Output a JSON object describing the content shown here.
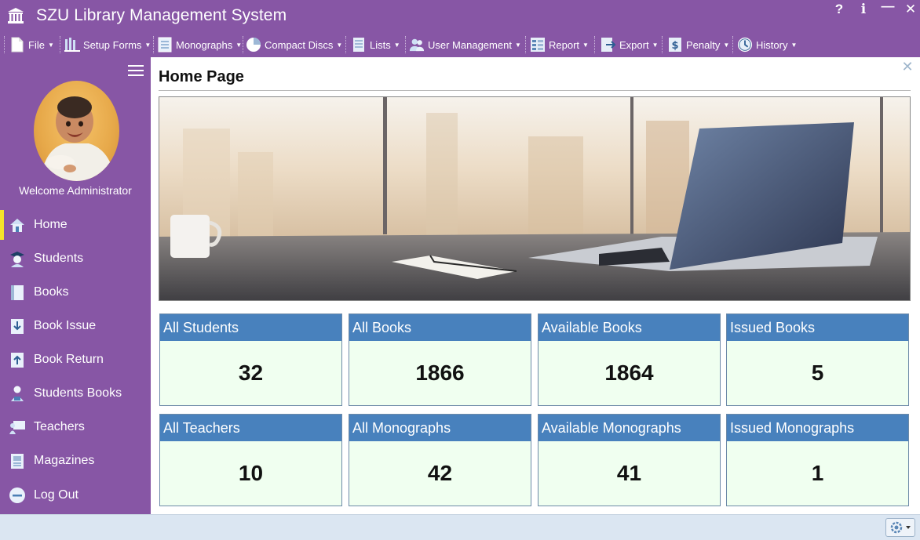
{
  "window": {
    "title": "SZU Library Management System",
    "help_label": "?",
    "info_label": "i",
    "minimize_label": "—",
    "close_label": "✕"
  },
  "menu": [
    {
      "label": "File",
      "icon": "document-icon"
    },
    {
      "label": "Setup Forms",
      "icon": "form-icon"
    },
    {
      "label": "Monographs",
      "icon": "monograph-icon"
    },
    {
      "label": "Compact Discs",
      "icon": "disc-icon"
    },
    {
      "label": "Lists",
      "icon": "list-icon"
    },
    {
      "label": "User Management",
      "icon": "users-icon"
    },
    {
      "label": "Report",
      "icon": "report-icon"
    },
    {
      "label": "Export",
      "icon": "export-icon"
    },
    {
      "label": "Penalty",
      "icon": "dollar-icon"
    },
    {
      "label": "History",
      "icon": "clock-icon"
    }
  ],
  "sidebar": {
    "welcome": "Welcome Administrator",
    "items": [
      {
        "label": "Home",
        "icon": "home-icon",
        "active": true
      },
      {
        "label": "Students",
        "icon": "student-icon"
      },
      {
        "label": "Books",
        "icon": "book-icon"
      },
      {
        "label": "Book Issue",
        "icon": "download-icon"
      },
      {
        "label": "Book Return",
        "icon": "upload-icon"
      },
      {
        "label": "Students Books",
        "icon": "reader-icon"
      },
      {
        "label": "Teachers",
        "icon": "teacher-icon"
      },
      {
        "label": "Magazines",
        "icon": "magazine-icon"
      },
      {
        "label": "Log Out",
        "icon": "logout-icon"
      }
    ]
  },
  "main": {
    "title": "Home Page",
    "tiles": [
      {
        "label": "All Students",
        "value": "32"
      },
      {
        "label": "All Books",
        "value": "1866"
      },
      {
        "label": "Available Books",
        "value": "1864"
      },
      {
        "label": "Issued Books",
        "value": "5"
      },
      {
        "label": "All Teachers",
        "value": "10"
      },
      {
        "label": "All Monographs",
        "value": "42"
      },
      {
        "label": "Available Monographs",
        "value": "41"
      },
      {
        "label": "Issued Monographs",
        "value": "1"
      }
    ]
  },
  "colors": {
    "chrome": "#8756a5",
    "tile_header": "#4881bd",
    "tile_body": "#f0fff0",
    "active_indicator": "#f5e32a",
    "statusbar": "#dbe6f2"
  }
}
